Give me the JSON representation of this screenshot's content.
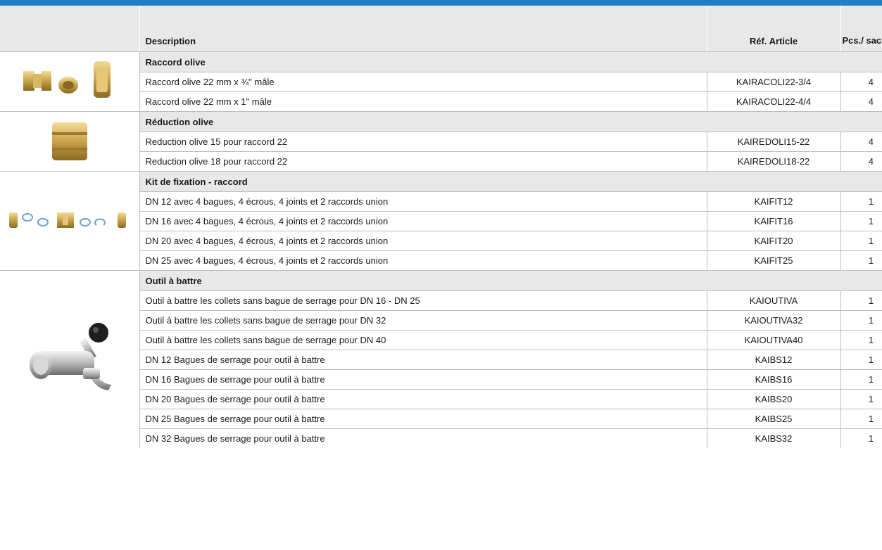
{
  "header": {
    "description": "Description",
    "reference": "Réf. Article",
    "pieces": "Pcs./ sac"
  },
  "groups": [
    {
      "title": "Raccord olive",
      "image_icon": "brass-olive-fittings-icon",
      "items": [
        {
          "description": "Raccord olive 22 mm x ¾\" mâle",
          "ref": "KAIRACOLI22-3/4",
          "qty": "4"
        },
        {
          "description": "Raccord olive 22 mm x 1\" mâle",
          "ref": "KAIRACOLI22-4/4",
          "qty": "4"
        }
      ]
    },
    {
      "title": "Réduction olive",
      "image_icon": "brass-reducer-icon",
      "items": [
        {
          "description": "Reduction olive 15 pour raccord 22",
          "ref": "KAIREDOLI15-22",
          "qty": "4"
        },
        {
          "description": "Reduction olive 18 pour raccord 22",
          "ref": "KAIREDOLI18-22",
          "qty": "4"
        }
      ]
    },
    {
      "title": "Kit de fixation - raccord",
      "image_icon": "fixing-kit-icon",
      "items": [
        {
          "description": "DN 12 avec 4 bagues, 4 écrous, 4 joints et 2 raccords union",
          "ref": "KAIFIT12",
          "qty": "1"
        },
        {
          "description": "DN 16 avec 4 bagues, 4 écrous, 4 joints et 2 raccords union",
          "ref": "KAIFIT16",
          "qty": "1"
        },
        {
          "description": "DN 20 avec 4 bagues, 4 écrous, 4 joints et 2 raccords union",
          "ref": "KAIFIT20",
          "qty": "1"
        },
        {
          "description": "DN 25 avec 4 bagues, 4 écrous, 4 joints et 2 raccords union",
          "ref": "KAIFIT25",
          "qty": "1"
        }
      ]
    },
    {
      "title": "Outil à battre",
      "image_icon": "flaring-tool-icon",
      "items": [
        {
          "description": "Outil à battre les collets sans bague de serrage pour DN 16 - DN 25",
          "ref": "KAIOUTIVA",
          "qty": "1"
        },
        {
          "description": "Outil à battre les collets sans bague de serrage pour DN 32",
          "ref": "KAIOUTIVA32",
          "qty": "1"
        },
        {
          "description": "Outil à battre les collets sans bague de serrage pour DN 40",
          "ref": "KAIOUTIVA40",
          "qty": "1"
        },
        {
          "description": "DN 12 Bagues de serrage pour outil à battre",
          "ref": "KAIBS12",
          "qty": "1"
        },
        {
          "description": "DN 16 Bagues de serrage pour outil à battre",
          "ref": "KAIBS16",
          "qty": "1"
        },
        {
          "description": "DN 20 Bagues de serrage pour outil à battre",
          "ref": "KAIBS20",
          "qty": "1"
        },
        {
          "description": "DN 25 Bagues de serrage pour outil à battre",
          "ref": "KAIBS25",
          "qty": "1"
        },
        {
          "description": "DN 32 Bagues de serrage pour outil à battre",
          "ref": "KAIBS32",
          "qty": "1"
        }
      ]
    }
  ],
  "colors": {
    "accent_bar": "#1e7fc2",
    "header_bg": "#e8e8e8",
    "border": "#bdbdbd",
    "brass": "#c9a24a"
  }
}
